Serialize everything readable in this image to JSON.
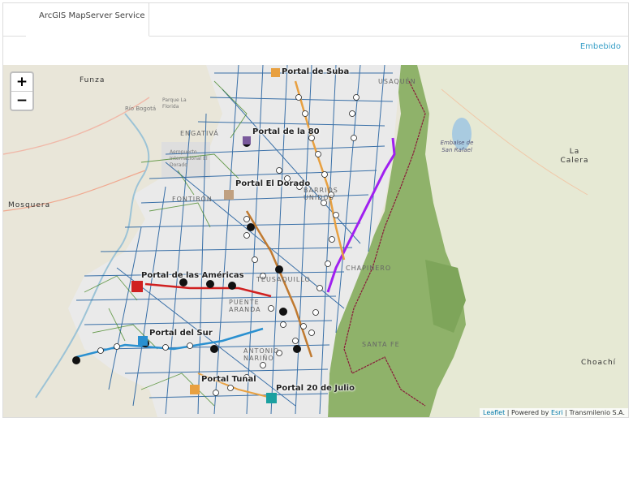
{
  "tabs": [
    {
      "label": "ArcGIS MapServer Service"
    }
  ],
  "embed_link": "Embebido",
  "map": {
    "zoom_in": "+",
    "zoom_out": "−",
    "attribution": {
      "leaflet": "Leaflet",
      "powered": " | Powered by ",
      "esri": "Esri",
      "owner": " | Transmilenio S.A."
    },
    "places": [
      {
        "name": "Funza"
      },
      {
        "name": "Mosquera"
      },
      {
        "name": "La Calera"
      },
      {
        "name": "Choachí"
      },
      {
        "name": "Embalse de San Rafael"
      },
      {
        "name": "Río Bogotá"
      },
      {
        "name": "Aeropuerto Internacional El Dorado"
      },
      {
        "name": "Parque La Florida"
      }
    ],
    "portals": [
      {
        "name": "Portal de Suba"
      },
      {
        "name": "Portal de la 80"
      },
      {
        "name": "Portal El Dorado"
      },
      {
        "name": "Portal de las Américas"
      },
      {
        "name": "Portal del Sur"
      },
      {
        "name": "Portal Tunal"
      },
      {
        "name": "Portal 20 de Julio"
      }
    ],
    "neighborhoods": [
      {
        "name": "ENGATIVÁ"
      },
      {
        "name": "FONTIBÓN"
      },
      {
        "name": "CHAPINERO"
      },
      {
        "name": "TEUSAQUILLO"
      },
      {
        "name": "SANTA FE"
      },
      {
        "name": "USAQUÉN"
      },
      {
        "name": "BARRIOS UNIDOS"
      },
      {
        "name": "ANTONIO NARIÑO"
      },
      {
        "name": "PUENTE ARANDA"
      }
    ],
    "colors": {
      "trunk": "#1a5a9c",
      "feeder": "#4a8a2a",
      "cable": "#a020f0",
      "eastern_hills": "#8fb26a",
      "urban": "#ececec"
    }
  }
}
